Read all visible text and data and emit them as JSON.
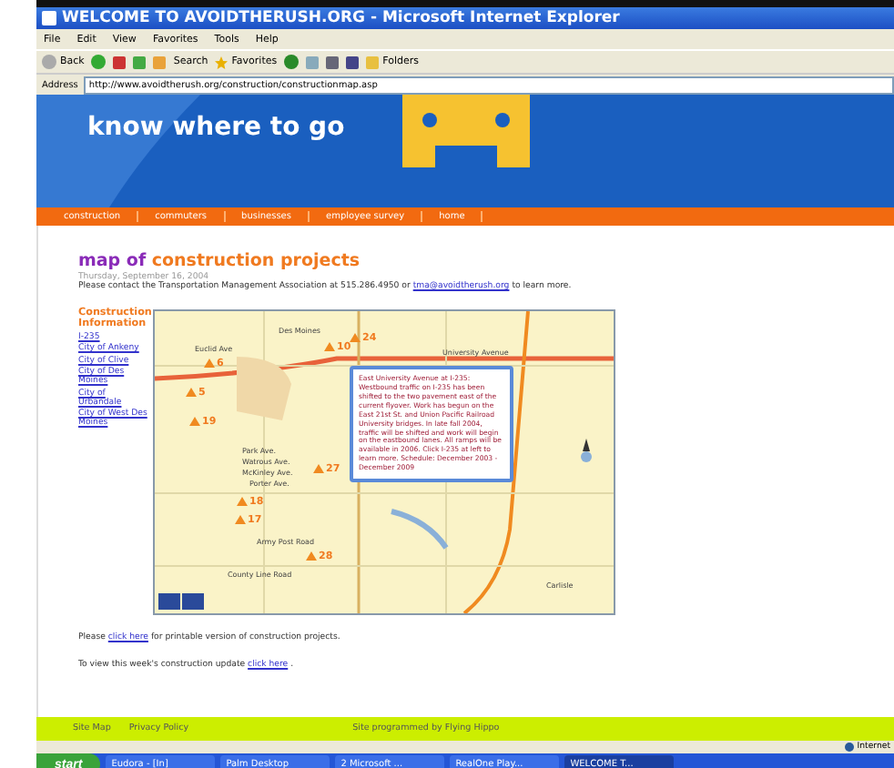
{
  "window": {
    "title": "WELCOME TO AVOIDTHERUSH.ORG - Microsoft Internet Explorer"
  },
  "menu": [
    "File",
    "Edit",
    "View",
    "Favorites",
    "Tools",
    "Help"
  ],
  "toolbar": {
    "back": "Back",
    "search": "Search",
    "favorites": "Favorites",
    "folders": "Folders"
  },
  "address": {
    "label": "Address",
    "url": "http://www.avoidtherush.org/construction/constructionmap.asp"
  },
  "banner": {
    "tagline": "know where to go"
  },
  "nav": [
    "construction",
    "commuters",
    "businesses",
    "employee survey",
    "home"
  ],
  "heading": {
    "lead": "map of",
    "rest": "construction projects"
  },
  "date": "Thursday, September 16, 2004",
  "contact": {
    "before": "Please contact the Transportation Management Association at 515.286.4950 or",
    "link": "tma@avoidtherush.org",
    "after": "to learn more."
  },
  "sidebar": {
    "title": "Construction Information",
    "links": [
      "I-235",
      "City of Ankeny",
      "City of Clive",
      "City of Des Moines",
      "City of Urbandale",
      "City of West Des Moines"
    ]
  },
  "map": {
    "markers": [
      "10",
      "24",
      "6",
      "5",
      "19",
      "27",
      "18",
      "17",
      "28"
    ],
    "labels": [
      "Des Moines",
      "Euclid Ave",
      "University Avenue",
      "Park Ave.",
      "Watrous Ave.",
      "McKinley Ave.",
      "Porter Ave.",
      "Army Post Road",
      "County Line Road",
      "Carlisle"
    ],
    "popup": "East University Avenue at I-235: Westbound traffic on I-235 has been shifted to the two pavement east of the current flyover. Work has begun on the East 21st St. and Union Pacific Railroad University bridges. In late fall 2004, traffic will be shifted and work will begin on the eastbound lanes. All ramps will be available in 2006. Click I-235 at left to learn more. Schedule: December 2003 - December 2009"
  },
  "notes": [
    {
      "before": "Please",
      "link": "click here",
      "after": "for printable version of construction projects."
    },
    {
      "before": "To view this week's construction update",
      "link": "click here",
      "after": "."
    }
  ],
  "footer": {
    "links": [
      "Site Map",
      "Privacy Policy"
    ],
    "credit": "Site programmed by Flying Hippo"
  },
  "status_bar": {
    "zone": "Internet"
  },
  "taskbar": {
    "start": "start",
    "tasks": [
      {
        "label": "Eudora - [In]",
        "selected": false
      },
      {
        "label": "Palm Desktop",
        "selected": false
      },
      {
        "label": "2 Microsoft ...",
        "selected": false
      },
      {
        "label": "RealOne Play...",
        "selected": false
      },
      {
        "label": "WELCOME T...",
        "selected": true
      }
    ]
  }
}
